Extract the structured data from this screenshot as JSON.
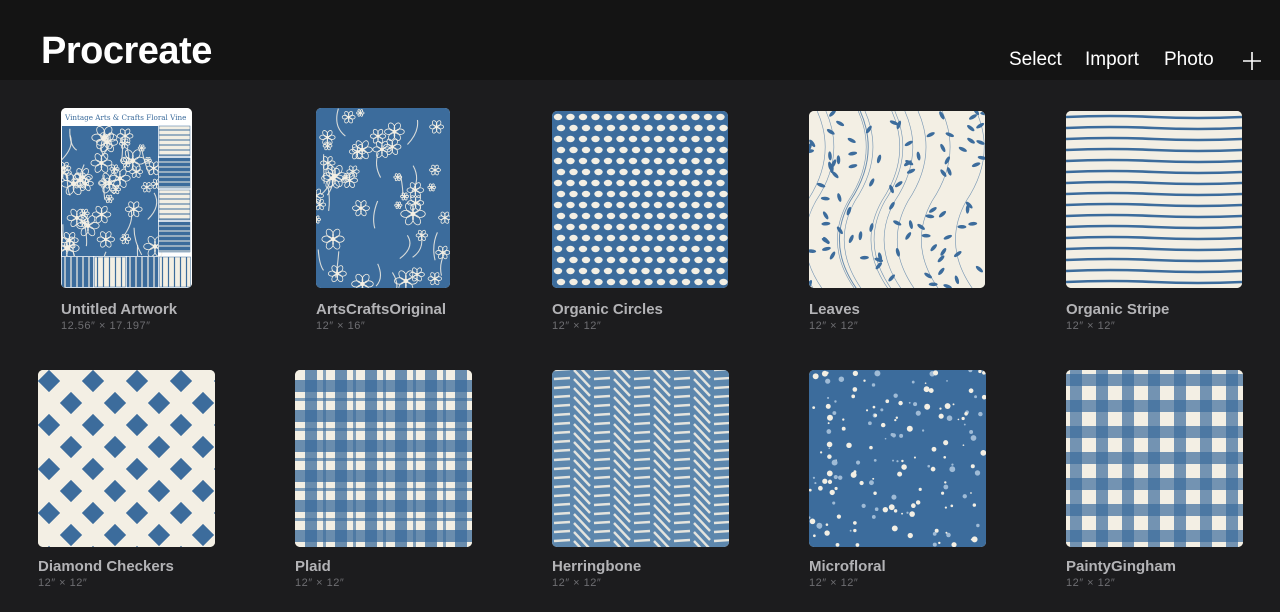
{
  "app": {
    "title": "Procreate"
  },
  "toolbar": {
    "select_label": "Select",
    "import_label": "Import",
    "photo_label": "Photo"
  },
  "colors": {
    "pattern_blue": "#3c6c9c",
    "cream": "#f3efe4",
    "background": "#1c1c1e"
  },
  "artworks": [
    {
      "name": "Untitled Artwork",
      "dims": "12.56″ × 17.197″",
      "pattern": "sampler",
      "thumb_text": "Vintage Arts & Crafts Floral Vine"
    },
    {
      "name": "ArtsCraftsOriginal",
      "dims": "12″ × 16″",
      "pattern": "floral"
    },
    {
      "name": "Organic Circles",
      "dims": "12″ × 12″",
      "pattern": "circles"
    },
    {
      "name": "Leaves",
      "dims": "12″ × 12″",
      "pattern": "leaves"
    },
    {
      "name": "Organic Stripe",
      "dims": "12″ × 12″",
      "pattern": "stripes"
    },
    {
      "name": "Diamond Checkers",
      "dims": "12″ × 12″",
      "pattern": "diamonds"
    },
    {
      "name": "Plaid",
      "dims": "12″ × 12″",
      "pattern": "plaid"
    },
    {
      "name": "Herringbone",
      "dims": "12″ × 12″",
      "pattern": "herringbone"
    },
    {
      "name": "Microfloral",
      "dims": "12″ × 12″",
      "pattern": "microfloral"
    },
    {
      "name": "PaintyGingham",
      "dims": "12″ × 12″",
      "pattern": "gingham"
    }
  ]
}
